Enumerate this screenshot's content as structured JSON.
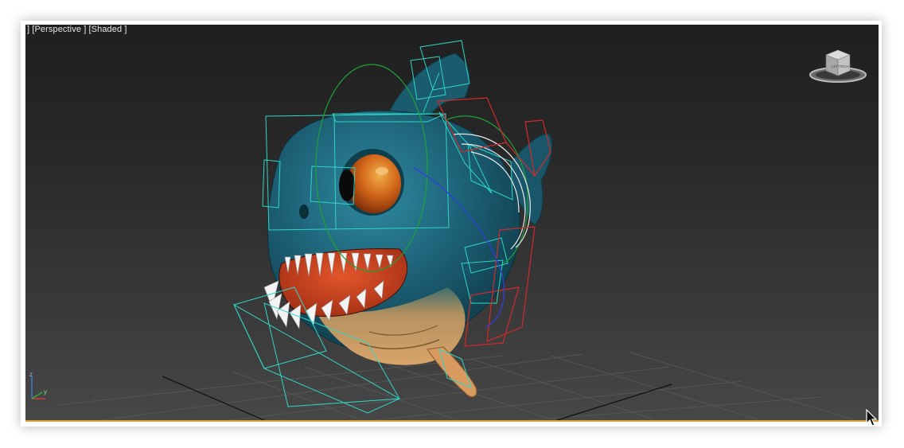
{
  "viewport": {
    "label": "] [Perspective ] [Shaded ]",
    "active_border_color": "#d8a03a",
    "background_top": "#1f1f1f",
    "background_bottom": "#474747"
  },
  "viewcube": {
    "faces": [
      "TOP",
      "LEFT",
      "RIGHT"
    ],
    "icon": "viewcube-icon"
  },
  "axis_tripod": {
    "x_label": "x",
    "y_label": "y",
    "z_label": "z"
  },
  "scene": {
    "object": "piranha-fish-model",
    "rig_colors": {
      "cyan": "#2fd6c6",
      "green": "#1ea23a",
      "red": "#d22a2a",
      "white": "#e8e8e8",
      "blue": "#2f3fd8"
    },
    "body_color": "#1d5f74",
    "belly_color": "#d4a066",
    "eye_color": "#c8581a"
  },
  "cursor": {
    "icon": "mouse-pointer-icon"
  }
}
